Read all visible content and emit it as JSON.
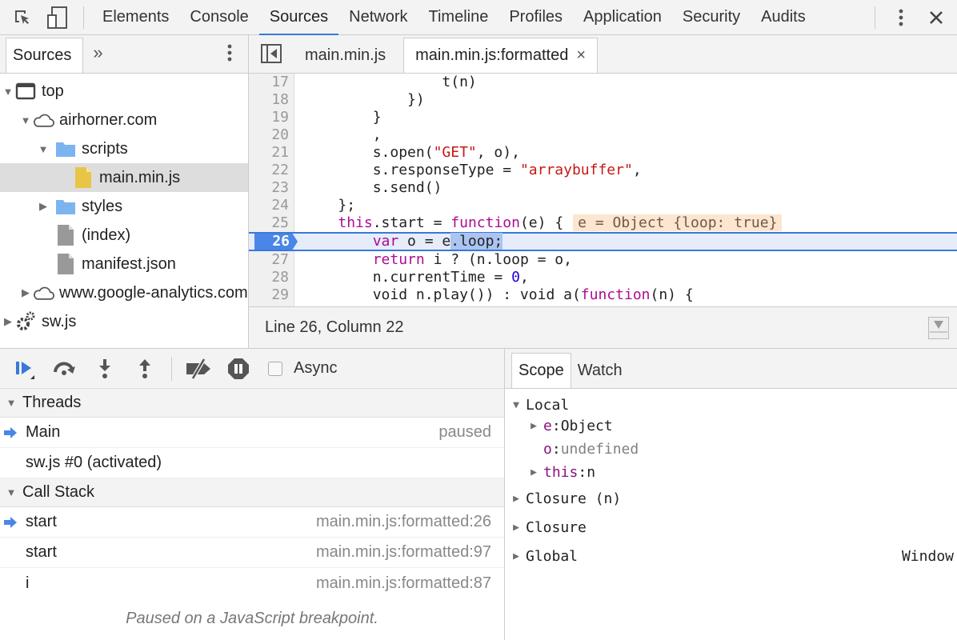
{
  "toolbar": {
    "tabs": [
      "Elements",
      "Console",
      "Sources",
      "Network",
      "Timeline",
      "Profiles",
      "Application",
      "Security",
      "Audits"
    ],
    "active_tab": "Sources",
    "icons": [
      "inspect-element-icon",
      "device-toolbar-icon",
      "more-vertical-icon",
      "close-icon"
    ]
  },
  "navigator": {
    "tab_label": "Sources",
    "more_tabs": "»",
    "tree": [
      {
        "label": "top",
        "icon": "frame-icon",
        "expanded": true
      },
      {
        "label": "airhorner.com",
        "icon": "cloud-icon",
        "expanded": true
      },
      {
        "label": "scripts",
        "icon": "folder-icon",
        "expanded": true
      },
      {
        "label": "main.min.js",
        "icon": "script-file-icon",
        "selected": true
      },
      {
        "label": "styles",
        "icon": "folder-icon",
        "expanded": false
      },
      {
        "label": "(index)",
        "icon": "document-icon"
      },
      {
        "label": "manifest.json",
        "icon": "document-icon"
      },
      {
        "label": "www.google-analytics.com",
        "icon": "cloud-icon",
        "expanded": false
      },
      {
        "label": "sw.js",
        "icon": "service-worker-icon",
        "expanded": false
      }
    ]
  },
  "editor": {
    "tabs": [
      {
        "label": "main.min.js",
        "active": false
      },
      {
        "label": "main.min.js:formatted",
        "active": true,
        "close": "×"
      }
    ],
    "lines": [
      {
        "n": "17",
        "indent": "                ",
        "text": "t(n)"
      },
      {
        "n": "18",
        "indent": "            ",
        "text": "})"
      },
      {
        "n": "19",
        "indent": "        ",
        "text": "}"
      },
      {
        "n": "20",
        "indent": "        ",
        "text": ","
      },
      {
        "n": "21",
        "indent": "        ",
        "text_pre": "s.open(",
        "str": "\"GET\"",
        "text_post": ", o),"
      },
      {
        "n": "22",
        "indent": "        ",
        "text_pre": "s.responseType = ",
        "str": "\"arraybuffer\"",
        "text_post": ","
      },
      {
        "n": "23",
        "indent": "        ",
        "text": "s.send()"
      },
      {
        "n": "24",
        "indent": "    ",
        "text": "};"
      },
      {
        "n": "25",
        "indent": "    ",
        "kw1": "this",
        "text_mid": ".start = ",
        "kw2": "function",
        "text_post": "(e) {",
        "inline_value": "e = Object {loop: true}"
      },
      {
        "n": "26",
        "indent": "        ",
        "kw1": "var",
        "text_mid": " o = e",
        "highlight": ".loop;",
        "current": true
      },
      {
        "n": "27",
        "indent": "        ",
        "kw1": "return",
        "text_post": " i ? (n.loop = o,"
      },
      {
        "n": "28",
        "indent": "        ",
        "text_pre": "n.currentTime = ",
        "num": "0",
        "text_post": ","
      },
      {
        "n": "29",
        "indent": "        ",
        "text_pre": "void n.play()) : void a(",
        "kw2": "function",
        "text_post": "(n) {"
      }
    ],
    "status": "Line 26, Column 22"
  },
  "debugger": {
    "controls": [
      "resume-icon",
      "step-over-icon",
      "step-into-icon",
      "step-out-icon",
      "deactivate-breakpoints-icon",
      "pause-on-exceptions-icon"
    ],
    "async_label": "Async",
    "async_checked": false,
    "threads_title": "Threads",
    "threads": [
      {
        "name": "Main",
        "status": "paused",
        "current": true
      },
      {
        "name": "sw.js #0 (activated)",
        "status": "",
        "current": false
      }
    ],
    "callstack_title": "Call Stack",
    "callstack": [
      {
        "name": "start",
        "location": "main.min.js:formatted:26",
        "current": true
      },
      {
        "name": "start",
        "location": "main.min.js:formatted:97",
        "current": false
      },
      {
        "name": "i",
        "location": "main.min.js:formatted:87",
        "current": false
      }
    ],
    "paused_message": "Paused on a JavaScript breakpoint."
  },
  "scope": {
    "tabs": [
      "Scope",
      "Watch"
    ],
    "active_tab": "Scope",
    "local_label": "Local",
    "locals": [
      {
        "name": "e",
        "value": "Object",
        "expandable": true
      },
      {
        "name": "o",
        "value": "undefined",
        "expandable": false
      },
      {
        "name": "this",
        "value": "n",
        "expandable": true
      }
    ],
    "sections": [
      {
        "label": "Closure (n)",
        "value": ""
      },
      {
        "label": "Closure",
        "value": ""
      },
      {
        "label": "Global",
        "value": "Window"
      }
    ]
  },
  "colors": {
    "accent": "#3879d9",
    "breakpoint": "#4a86e8",
    "keyword": "#aa0d91",
    "string": "#c41a16",
    "number": "#1c00cf",
    "inline_value_bg": "#fde5cf"
  }
}
